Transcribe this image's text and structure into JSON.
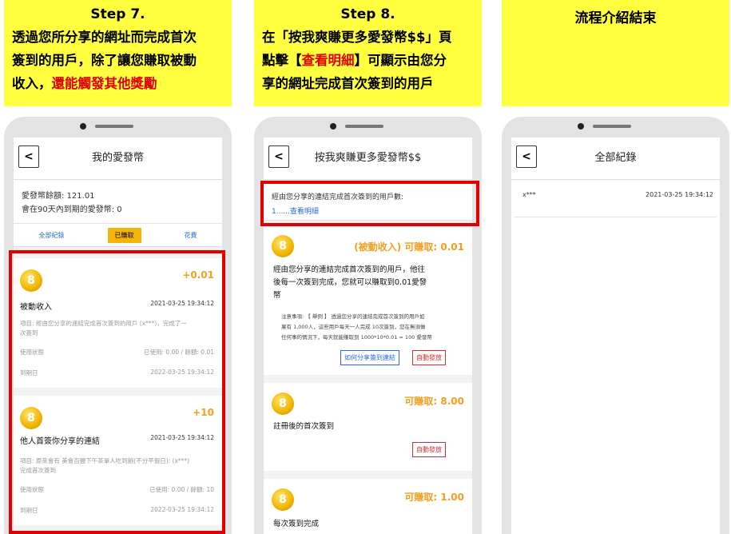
{
  "step7": {
    "title": "Step 7.",
    "line1": "透過您所分享的網址而完成首次",
    "line2": "簽到的用戶，除了讓您賺取被動",
    "line3a": "收入，",
    "line3b": "還能觸發其他獎勵"
  },
  "step8": {
    "title": "Step 8.",
    "line1": "在「按我爽賺更多愛發幣$$」頁",
    "line2a": "點擊【",
    "line2b": "查看明細",
    "line2c": "】可顯示由您分",
    "line3": "享的網址完成首次簽到的用戶"
  },
  "end_text": "流程介紹結束",
  "phone1": {
    "back": "<",
    "title": "我的愛發幣",
    "balance": "愛發幣餘額: 121.01",
    "expiring": "會在90天內到期的愛發幣: 0",
    "tabs": [
      "全部紀錄",
      "已賺取",
      "花費"
    ],
    "cards": [
      {
        "amount": "+0.01",
        "name": "被動收入",
        "date": "2021-03-25 19:34:12",
        "desc1": "項目: 經由您分享的連結完成首次簽到的用戶 (x***)，完成了一",
        "desc2": "次簽到",
        "status_label": "使用狀態",
        "status_value": "已使用: 0.00 / 餘額: 0.01",
        "expiry_label": "到期日",
        "expiry_value": "2022-03-25 19:34:12"
      },
      {
        "amount": "+10",
        "name": "他人首簽你分享的連結",
        "date": "2021-03-25 19:34:12",
        "desc1": "項目: 原來會有 美會百鹽下午茶單人吃到飽(不分平假日): (x***)",
        "desc2": "完成首次簽到",
        "status_label": "使用狀態",
        "status_value": "已使用: 0.00 / 餘額: 10",
        "expiry_label": "到期日",
        "expiry_value": "2022-03-25 19:34:12"
      }
    ]
  },
  "phone2": {
    "back": "<",
    "title": "按我爽賺更多愛發幣$$",
    "users_label": "經由您分享的連結完成首次簽到的用戶數:",
    "users_link": "1......查看明細",
    "cards": [
      {
        "amount": "(被動收入) 可賺取: 0.01",
        "desc_l1": "經由您分享的連結完成首次簽到的用戶，他往",
        "desc_l2": "後每一次簽到完成，您就可以賺取到0.01愛發",
        "desc_l3": "幣",
        "note_l1": "注意事項: 【 舉例 】 透過您分享的連結完成首次簽到的用戶如",
        "note_l2": "果有 1,000人，這些用戶每天一人完成 10次簽到，您在無須做",
        "note_l3": "任何事的情況下，每天就能賺取到 1000*10*0.01 = 100 愛發幣",
        "btn_share": "如何分享簽到連結",
        "btn_auto": "自動發放"
      },
      {
        "amount": "可賺取: 8.00",
        "desc": "註冊後的首次簽到",
        "btn_auto": "自動發放"
      },
      {
        "amount": "可賺取: 1.00",
        "desc": "每次簽到完成"
      }
    ]
  },
  "phone3": {
    "back": "<",
    "title": "全部紀錄",
    "user": "x***",
    "date": "2021-03-25 19:34:12"
  },
  "coin_glyph": "8"
}
